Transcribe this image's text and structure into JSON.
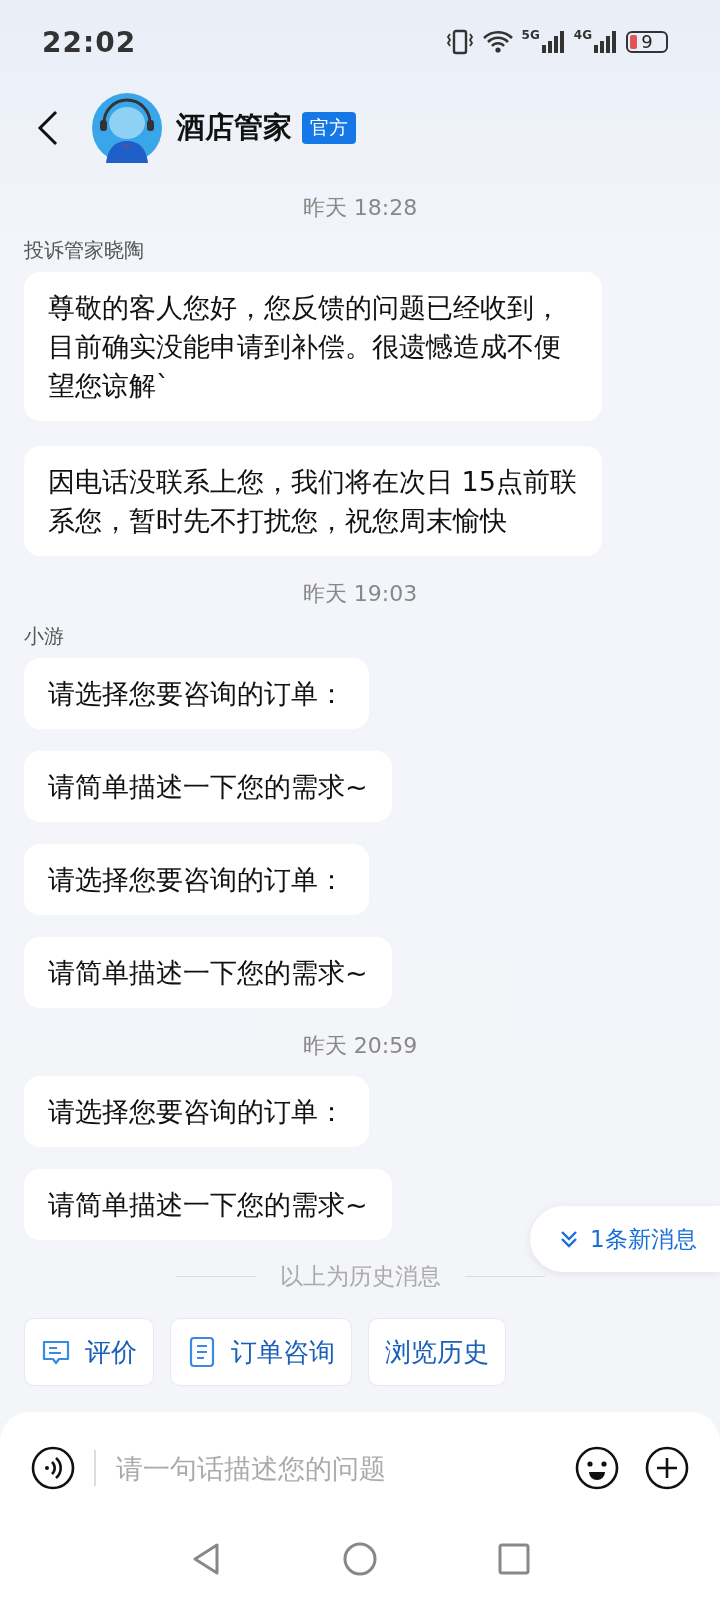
{
  "status_bar": {
    "time": "22:02",
    "network_1": "5G",
    "network_2": "4G",
    "battery": "9"
  },
  "header": {
    "title": "酒店管家",
    "badge": "官方"
  },
  "groups": [
    {
      "time": "昨天 18:28",
      "sender": "投诉管家晓陶",
      "messages": [
        "尊敬的客人您好，您反馈的问题已经收到，目前确实没能申请到补偿。很遗憾造成不便望您谅解`",
        "因电话没联系上您，我们将在次日 15点前联系您，暂时先不打扰您，祝您周末愉快"
      ]
    },
    {
      "time": "昨天 19:03",
      "sender": "小游",
      "messages": [
        "请选择您要咨询的订单：",
        "请简单描述一下您的需求~",
        "请选择您要咨询的订单：",
        "请简单描述一下您的需求~"
      ]
    },
    {
      "time": "昨天 20:59",
      "messages": [
        "请选择您要咨询的订单：",
        "请简单描述一下您的需求~"
      ]
    }
  ],
  "history_divider": "以上为历史消息",
  "new_messages": "1条新消息",
  "quick_actions": [
    {
      "label": "评价",
      "kind": "comment"
    },
    {
      "label": "订单咨询",
      "kind": "document"
    },
    {
      "label": "浏览历史",
      "kind": "plain"
    }
  ],
  "input": {
    "placeholder": "请一句话描述您的问题"
  }
}
